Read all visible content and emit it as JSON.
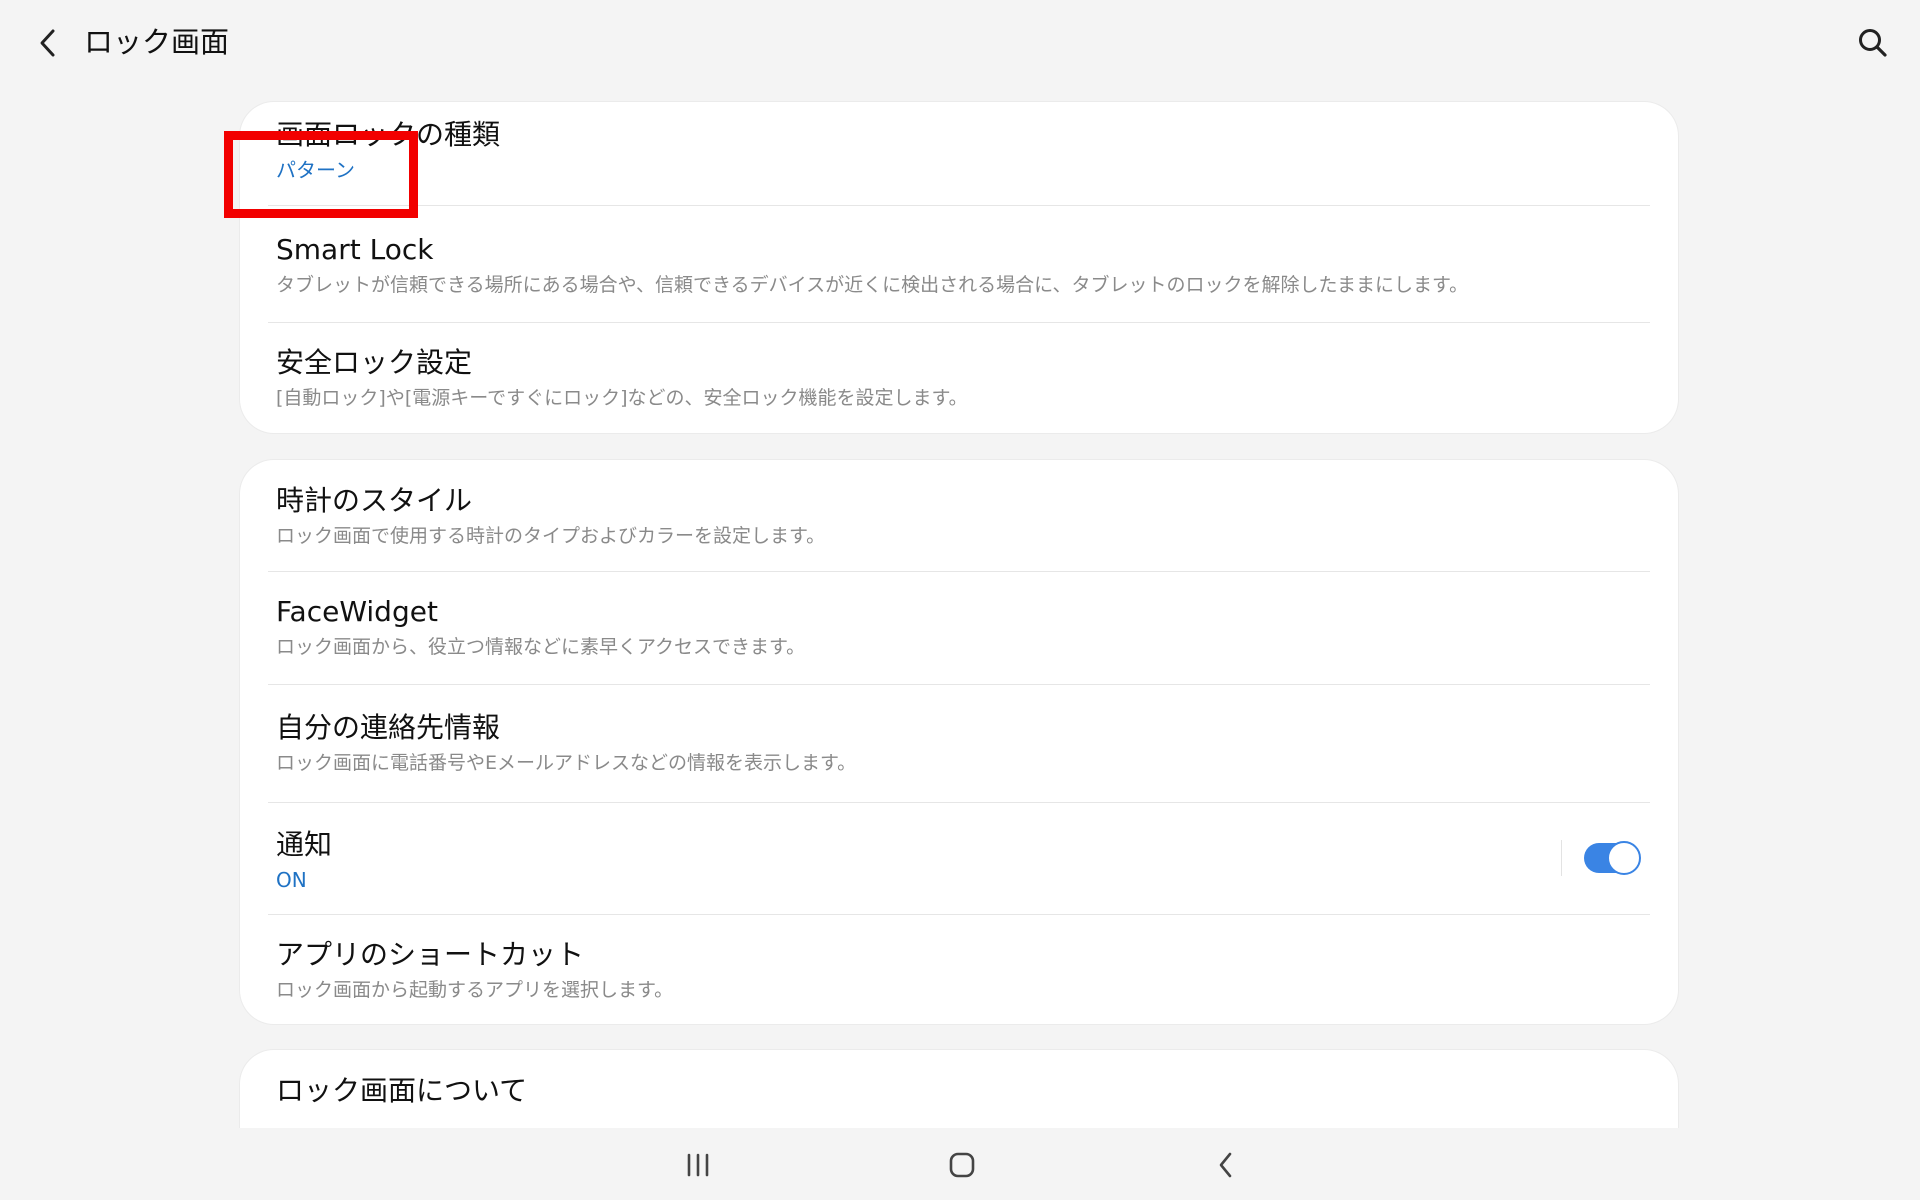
{
  "header": {
    "title": "ロック画面",
    "back_icon": "chevron-left-icon",
    "search_icon": "search-icon"
  },
  "cards": [
    {
      "items": [
        {
          "title": "画面ロックの種類",
          "subtitle": "パターン"
        },
        {
          "title": "Smart Lock",
          "subtitle": "タブレットが信頼できる場所にある場合や、信頼できるデバイスが近くに検出される場合に、タブレットのロックを解除したままにします。"
        },
        {
          "title": "安全ロック設定",
          "subtitle": "[自動ロック]や[電源キーですぐにロック]などの、安全ロック機能を設定します。"
        }
      ]
    },
    {
      "items": [
        {
          "title": "時計のスタイル",
          "subtitle": "ロック画面で使用する時計のタイプおよびカラーを設定します。"
        },
        {
          "title": "FaceWidget",
          "subtitle": "ロック画面から、役立つ情報などに素早くアクセスできます。"
        },
        {
          "title": "自分の連絡先情報",
          "subtitle": "ロック画面に電話番号やEメールアドレスなどの情報を表示します。"
        },
        {
          "title": "通知",
          "subtitle": "ON",
          "toggle_on": true
        },
        {
          "title": "アプリのショートカット",
          "subtitle": "ロック画面から起動するアプリを選択します。"
        }
      ]
    },
    {
      "items": [
        {
          "title": "ロック画面について"
        }
      ]
    }
  ],
  "navbar": {
    "recents_icon": "recents-icon",
    "home_icon": "home-icon",
    "back_icon": "back-icon"
  },
  "colors": {
    "accent": "#1f72c4",
    "toggle": "#3a84e4",
    "highlight": "#f20000",
    "background": "#f4f4f4"
  }
}
